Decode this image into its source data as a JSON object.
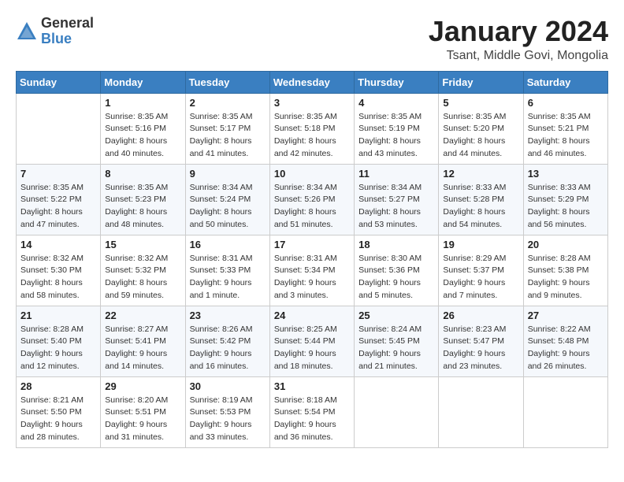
{
  "logo": {
    "general": "General",
    "blue": "Blue"
  },
  "title": "January 2024",
  "subtitle": "Tsant, Middle Govi, Mongolia",
  "days_header": [
    "Sunday",
    "Monday",
    "Tuesday",
    "Wednesday",
    "Thursday",
    "Friday",
    "Saturday"
  ],
  "weeks": [
    [
      {
        "day": "",
        "info": ""
      },
      {
        "day": "1",
        "info": "Sunrise: 8:35 AM\nSunset: 5:16 PM\nDaylight: 8 hours\nand 40 minutes."
      },
      {
        "day": "2",
        "info": "Sunrise: 8:35 AM\nSunset: 5:17 PM\nDaylight: 8 hours\nand 41 minutes."
      },
      {
        "day": "3",
        "info": "Sunrise: 8:35 AM\nSunset: 5:18 PM\nDaylight: 8 hours\nand 42 minutes."
      },
      {
        "day": "4",
        "info": "Sunrise: 8:35 AM\nSunset: 5:19 PM\nDaylight: 8 hours\nand 43 minutes."
      },
      {
        "day": "5",
        "info": "Sunrise: 8:35 AM\nSunset: 5:20 PM\nDaylight: 8 hours\nand 44 minutes."
      },
      {
        "day": "6",
        "info": "Sunrise: 8:35 AM\nSunset: 5:21 PM\nDaylight: 8 hours\nand 46 minutes."
      }
    ],
    [
      {
        "day": "7",
        "info": "Sunrise: 8:35 AM\nSunset: 5:22 PM\nDaylight: 8 hours\nand 47 minutes."
      },
      {
        "day": "8",
        "info": "Sunrise: 8:35 AM\nSunset: 5:23 PM\nDaylight: 8 hours\nand 48 minutes."
      },
      {
        "day": "9",
        "info": "Sunrise: 8:34 AM\nSunset: 5:24 PM\nDaylight: 8 hours\nand 50 minutes."
      },
      {
        "day": "10",
        "info": "Sunrise: 8:34 AM\nSunset: 5:26 PM\nDaylight: 8 hours\nand 51 minutes."
      },
      {
        "day": "11",
        "info": "Sunrise: 8:34 AM\nSunset: 5:27 PM\nDaylight: 8 hours\nand 53 minutes."
      },
      {
        "day": "12",
        "info": "Sunrise: 8:33 AM\nSunset: 5:28 PM\nDaylight: 8 hours\nand 54 minutes."
      },
      {
        "day": "13",
        "info": "Sunrise: 8:33 AM\nSunset: 5:29 PM\nDaylight: 8 hours\nand 56 minutes."
      }
    ],
    [
      {
        "day": "14",
        "info": "Sunrise: 8:32 AM\nSunset: 5:30 PM\nDaylight: 8 hours\nand 58 minutes."
      },
      {
        "day": "15",
        "info": "Sunrise: 8:32 AM\nSunset: 5:32 PM\nDaylight: 8 hours\nand 59 minutes."
      },
      {
        "day": "16",
        "info": "Sunrise: 8:31 AM\nSunset: 5:33 PM\nDaylight: 9 hours\nand 1 minute."
      },
      {
        "day": "17",
        "info": "Sunrise: 8:31 AM\nSunset: 5:34 PM\nDaylight: 9 hours\nand 3 minutes."
      },
      {
        "day": "18",
        "info": "Sunrise: 8:30 AM\nSunset: 5:36 PM\nDaylight: 9 hours\nand 5 minutes."
      },
      {
        "day": "19",
        "info": "Sunrise: 8:29 AM\nSunset: 5:37 PM\nDaylight: 9 hours\nand 7 minutes."
      },
      {
        "day": "20",
        "info": "Sunrise: 8:28 AM\nSunset: 5:38 PM\nDaylight: 9 hours\nand 9 minutes."
      }
    ],
    [
      {
        "day": "21",
        "info": "Sunrise: 8:28 AM\nSunset: 5:40 PM\nDaylight: 9 hours\nand 12 minutes."
      },
      {
        "day": "22",
        "info": "Sunrise: 8:27 AM\nSunset: 5:41 PM\nDaylight: 9 hours\nand 14 minutes."
      },
      {
        "day": "23",
        "info": "Sunrise: 8:26 AM\nSunset: 5:42 PM\nDaylight: 9 hours\nand 16 minutes."
      },
      {
        "day": "24",
        "info": "Sunrise: 8:25 AM\nSunset: 5:44 PM\nDaylight: 9 hours\nand 18 minutes."
      },
      {
        "day": "25",
        "info": "Sunrise: 8:24 AM\nSunset: 5:45 PM\nDaylight: 9 hours\nand 21 minutes."
      },
      {
        "day": "26",
        "info": "Sunrise: 8:23 AM\nSunset: 5:47 PM\nDaylight: 9 hours\nand 23 minutes."
      },
      {
        "day": "27",
        "info": "Sunrise: 8:22 AM\nSunset: 5:48 PM\nDaylight: 9 hours\nand 26 minutes."
      }
    ],
    [
      {
        "day": "28",
        "info": "Sunrise: 8:21 AM\nSunset: 5:50 PM\nDaylight: 9 hours\nand 28 minutes."
      },
      {
        "day": "29",
        "info": "Sunrise: 8:20 AM\nSunset: 5:51 PM\nDaylight: 9 hours\nand 31 minutes."
      },
      {
        "day": "30",
        "info": "Sunrise: 8:19 AM\nSunset: 5:53 PM\nDaylight: 9 hours\nand 33 minutes."
      },
      {
        "day": "31",
        "info": "Sunrise: 8:18 AM\nSunset: 5:54 PM\nDaylight: 9 hours\nand 36 minutes."
      },
      {
        "day": "",
        "info": ""
      },
      {
        "day": "",
        "info": ""
      },
      {
        "day": "",
        "info": ""
      }
    ]
  ]
}
